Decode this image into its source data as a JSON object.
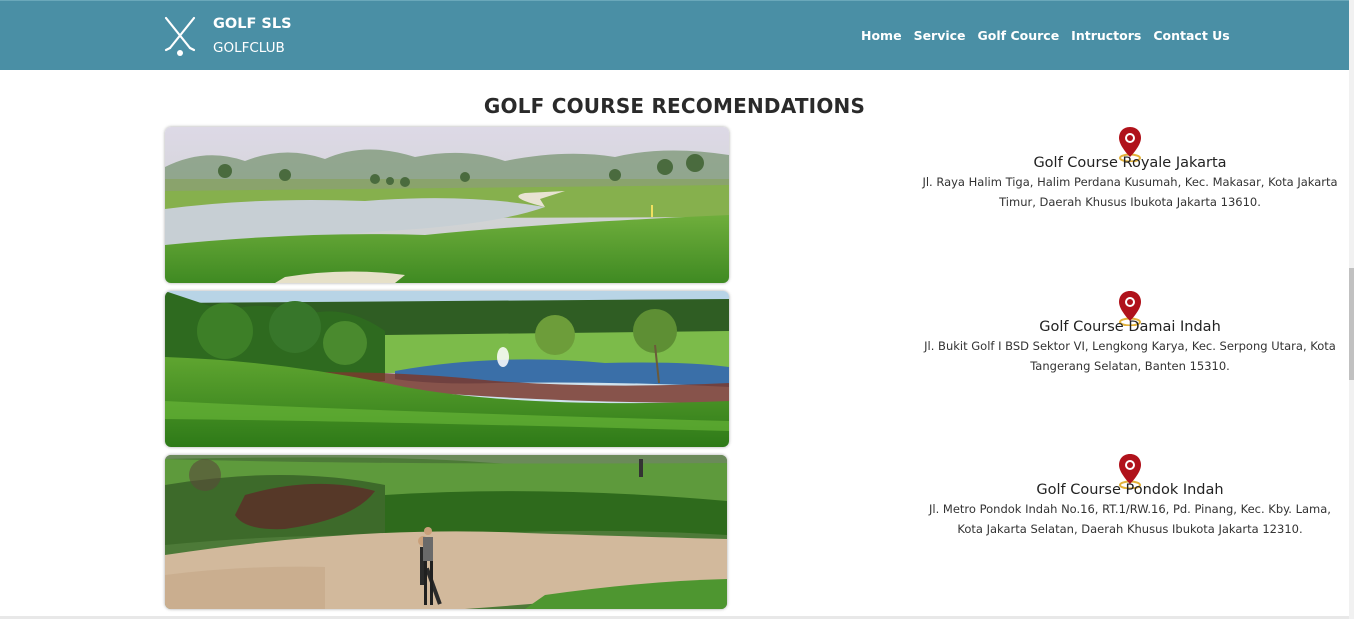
{
  "brand": {
    "name": "GOLF SLS",
    "sub": "GOLFCLUB",
    "logo_icon": "crossed-golf-clubs-icon"
  },
  "nav": [
    {
      "label": "Home"
    },
    {
      "label": "Service"
    },
    {
      "label": "Golf Cource"
    },
    {
      "label": "Intructors"
    },
    {
      "label": "Contact Us"
    }
  ],
  "page": {
    "title": "GOLF COURSE RECOMENDATIONS"
  },
  "courses": [
    {
      "name": "Golf Course Royale Jakarta",
      "address": "Jl. Raya Halim Tiga, Halim Perdana Kusumah, Kec. Makasar, Kota Jakarta Timur, Daerah Khusus Ibukota Jakarta 13610.",
      "icon": "map-pin-icon"
    },
    {
      "name": "Golf Course Damai Indah",
      "address": "Jl. Bukit Golf I BSD Sektor VI, Lengkong Karya, Kec. Serpong Utara, Kota Tangerang Selatan, Banten 15310.",
      "icon": "map-pin-icon"
    },
    {
      "name": "Golf Course Pondok Indah",
      "address": "Jl. Metro Pondok Indah No.16, RT.1/RW.16, Pd. Pinang, Kec. Kby. Lama, Kota Jakarta Selatan, Daerah Khusus Ibukota Jakarta 12310.",
      "icon": "map-pin-icon"
    }
  ],
  "colors": {
    "navbar": "#4a8fa5",
    "pin": "#b0121b",
    "pin_ring": "#e2b23a"
  }
}
